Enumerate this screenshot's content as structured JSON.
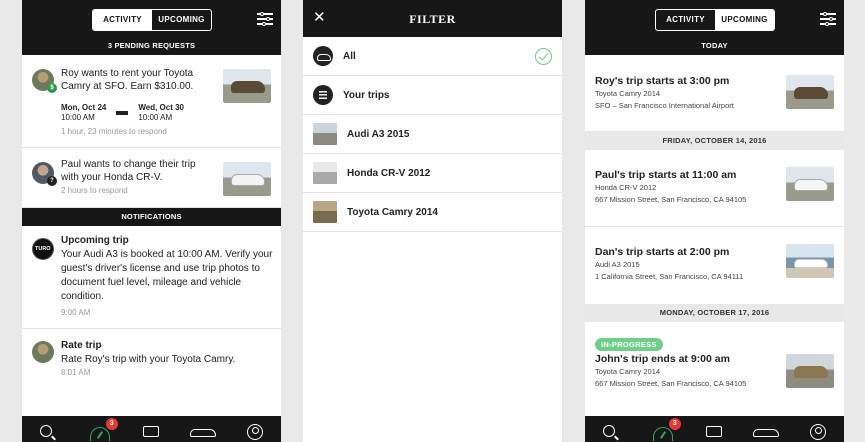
{
  "screen1": {
    "seg_activity": "ACTIVITY",
    "seg_upcoming": "UPCOMING",
    "pending_header": "3 PENDING REQUESTS",
    "requests": [
      {
        "text": "Roy wants to rent your Toyota Camry at SFO. Earn $310.00.",
        "start_day": "Mon, Oct 24",
        "start_time": "10:00 AM",
        "end_day": "Wed, Oct 30",
        "end_time": "10:00 AM",
        "meta": "1 hour, 23 minutes to respond",
        "badge": "$"
      },
      {
        "text": "Paul wants to change their trip with your Honda CR-V.",
        "meta": "2 hours to respond",
        "badge": "?"
      }
    ],
    "notifications_header": "NOTIFICATIONS",
    "notifications": [
      {
        "title": "Upcoming trip",
        "text": "Your Audi A3 is booked at 10:00 AM. Verify your guest's driver's license and use trip photos to document fuel level, mileage and vehicle condition.",
        "time": "9:00 AM",
        "logo": "TURO"
      },
      {
        "title": "Rate trip",
        "text": "Rate Roy's trip with your Toyota Camry.",
        "time": "8:01 AM"
      }
    ],
    "tab_badge": "3"
  },
  "screen2": {
    "title": "FILTER",
    "options": [
      {
        "label": "All",
        "selected": true
      },
      {
        "label": "Your trips"
      },
      {
        "label": "Audi A3 2015"
      },
      {
        "label": "Honda CR-V 2012"
      },
      {
        "label": "Toyota Camry 2014"
      }
    ]
  },
  "screen3": {
    "seg_activity": "ACTIVITY",
    "seg_upcoming": "UPCOMING",
    "today_header": "TODAY",
    "day2_header": "FRIDAY, OCTOBER 14, 2016",
    "day3_header": "MONDAY, OCTOBER 17, 2016",
    "trips": [
      {
        "title": "Roy's trip starts at 3:00 pm",
        "car": "Toyota Camry 2014",
        "location": "SFO – San Francisco International Airport"
      },
      {
        "title": "Paul's trip starts at 11:00 am",
        "car": "Honda CR-V 2012",
        "location": "667 Mission Street, San Francisco, CA 94105"
      },
      {
        "title": "Dan's trip starts at 2:00 pm",
        "car": "Audi A3 2015",
        "location": "1 California Street, San Francisco, CA 94111"
      },
      {
        "status": "IN-PROGRESS",
        "title": "John's trip ends at 9:00 am",
        "car": "Toyota Camry 2014",
        "location": "667 Mission Street, San Francisco, CA 94105"
      }
    ],
    "tab_badge": "3"
  },
  "colors": {
    "dark": "#171717",
    "accent_green": "#2faa5a",
    "badge_red": "#e53935",
    "pill_green": "#6fcf8a"
  }
}
